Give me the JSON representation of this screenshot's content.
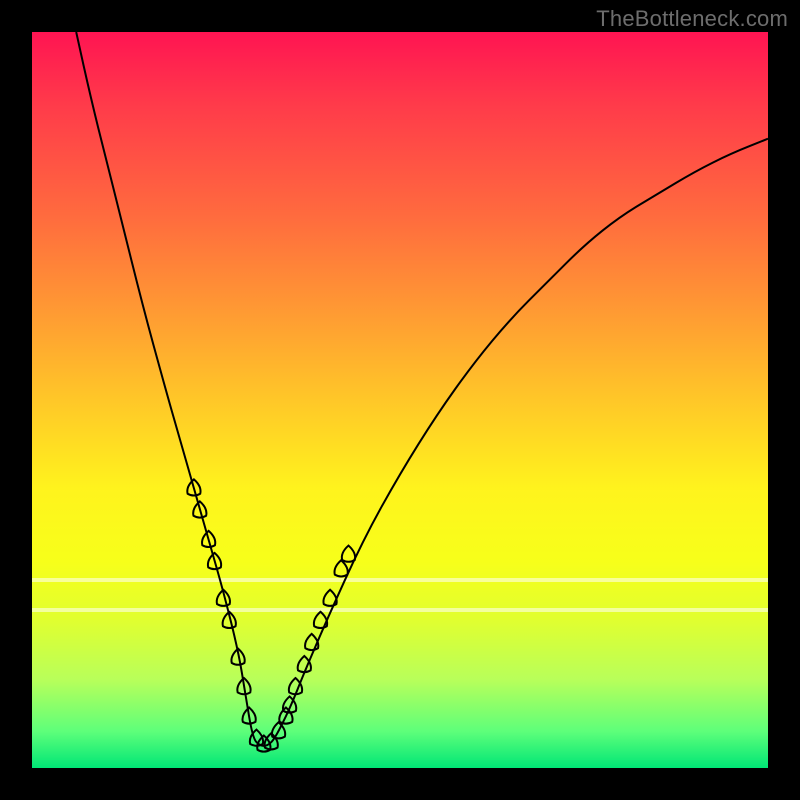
{
  "watermark": "TheBottleneck.com",
  "colors": {
    "frame": "#000000",
    "marker": "#d47b77",
    "curve": "#000000",
    "gradient_top": "#ff1452",
    "gradient_bottom": "#00e676"
  },
  "chart_data": {
    "type": "line",
    "title": "",
    "xlabel": "",
    "ylabel": "",
    "xlim": [
      0,
      100
    ],
    "ylim": [
      0,
      100
    ],
    "note": "V-shaped bottleneck curve. y=0 (bottom, green) is optimal; y=100 (top, red) is worst. Minimum near x≈30. Salmon markers decorate segments near the valley.",
    "series": [
      {
        "name": "bottleneck-curve",
        "x": [
          6,
          8,
          10,
          12,
          15,
          18,
          20,
          22,
          24,
          26,
          28,
          29,
          30,
          31,
          32,
          33,
          35,
          37,
          40,
          45,
          50,
          55,
          60,
          65,
          70,
          75,
          80,
          85,
          90,
          95,
          100
        ],
        "y": [
          100,
          91,
          83,
          75,
          63,
          52,
          45,
          38,
          31,
          24,
          16,
          10,
          4,
          3,
          3,
          4,
          8,
          13,
          20,
          31,
          40,
          48,
          55,
          61,
          66,
          71,
          75,
          78,
          81,
          83.5,
          85.5
        ]
      }
    ],
    "markers": {
      "name": "valley-markers",
      "points": [
        {
          "x": 22.0,
          "y": 38
        },
        {
          "x": 22.8,
          "y": 35
        },
        {
          "x": 24.0,
          "y": 31
        },
        {
          "x": 24.8,
          "y": 28
        },
        {
          "x": 26.0,
          "y": 23
        },
        {
          "x": 26.8,
          "y": 20
        },
        {
          "x": 28.0,
          "y": 15
        },
        {
          "x": 28.8,
          "y": 11
        },
        {
          "x": 29.5,
          "y": 7
        },
        {
          "x": 30.5,
          "y": 4
        },
        {
          "x": 31.5,
          "y": 3.2
        },
        {
          "x": 32.5,
          "y": 3.5
        },
        {
          "x": 33.5,
          "y": 5
        },
        {
          "x": 34.5,
          "y": 7
        },
        {
          "x": 35.0,
          "y": 8.5
        },
        {
          "x": 35.8,
          "y": 11
        },
        {
          "x": 37.0,
          "y": 14
        },
        {
          "x": 38.0,
          "y": 17
        },
        {
          "x": 39.2,
          "y": 20
        },
        {
          "x": 40.5,
          "y": 23
        },
        {
          "x": 42.0,
          "y": 27
        },
        {
          "x": 43.0,
          "y": 29
        }
      ]
    },
    "bands": [
      {
        "y": 25.5
      },
      {
        "y": 21.5
      }
    ]
  }
}
